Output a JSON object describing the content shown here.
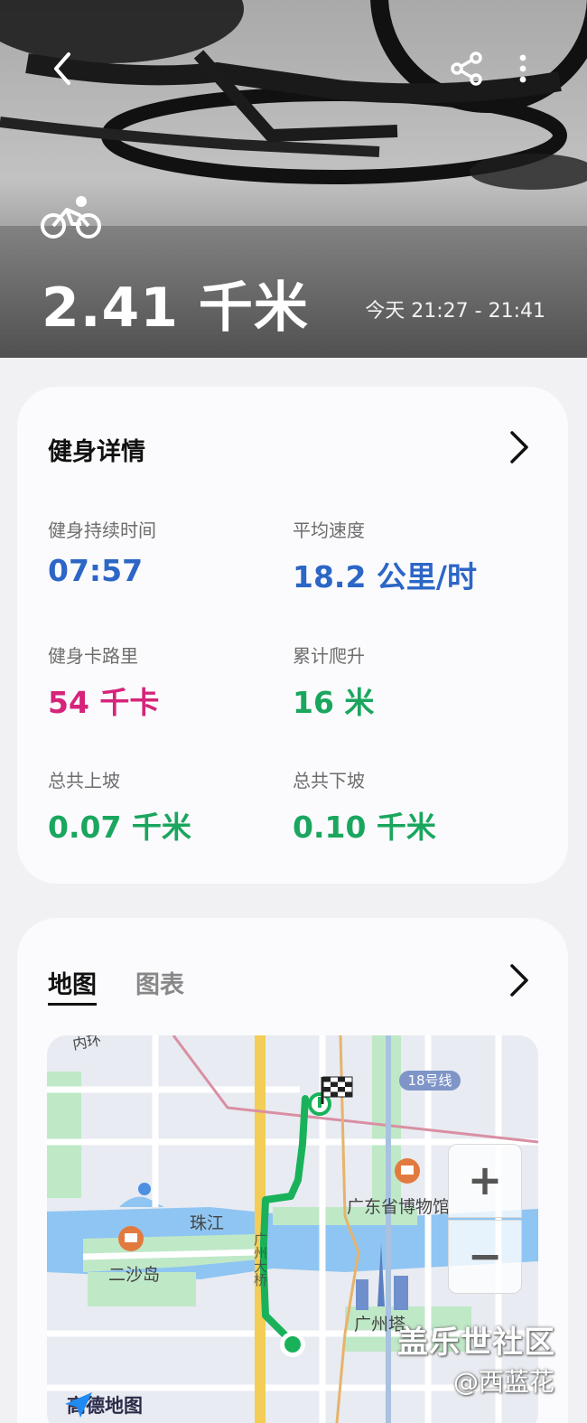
{
  "header": {
    "distance": "2.41 千米",
    "time_range": "今天 21:27 - 21:41",
    "activity_icon": "cycling-icon"
  },
  "details_card": {
    "title": "健身详情",
    "stats": [
      {
        "label": "健身持续时间",
        "value": "07:57",
        "color": "#2c66c6"
      },
      {
        "label": "平均速度",
        "value": "18.2 公里/时",
        "color": "#2c66c6"
      },
      {
        "label": "健身卡路里",
        "value": "54 千卡",
        "color": "#d6247a"
      },
      {
        "label": "累计爬升",
        "value": "16 米",
        "color": "#1aa65e"
      },
      {
        "label": "总共上坡",
        "value": "0.07 千米",
        "color": "#1aa65e"
      },
      {
        "label": "总共下坡",
        "value": "0.10 千米",
        "color": "#1aa65e"
      }
    ]
  },
  "map_card": {
    "tabs": [
      {
        "label": "地图",
        "active": true
      },
      {
        "label": "图表",
        "active": false
      }
    ],
    "map": {
      "labels": {
        "river": "珠江",
        "island": "二沙岛",
        "museum": "广东省博物馆",
        "tower": "广州塔",
        "metro": "18号线",
        "road_small": "内环",
        "road_vertical": "广州大桥"
      },
      "zoom_in": "+",
      "zoom_out": "−",
      "provider": "高德地图",
      "route_color": "#19b25a"
    }
  },
  "watermark": {
    "line1": "盖乐世社区",
    "line2": "@西蓝花"
  }
}
